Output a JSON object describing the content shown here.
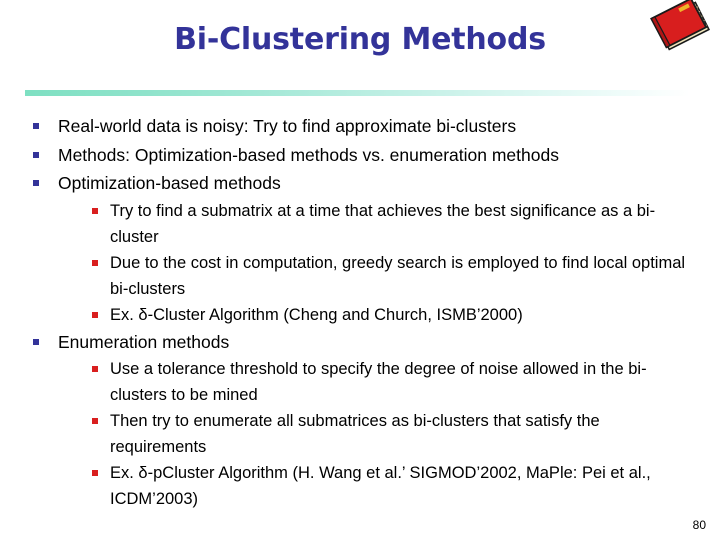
{
  "slide": {
    "title": "Bi-Clustering Methods",
    "page_number": "80",
    "title_color": "#333399",
    "divider_color": "#7ee0c2",
    "level1_bullet_color": "#333399",
    "level2_bullet_color": "#d91f1f",
    "decoration_icon": "red-book-icon"
  },
  "bullets": [
    {
      "level": 1,
      "text": "Real-world data is noisy: Try to find approximate bi-clusters"
    },
    {
      "level": 1,
      "text": "Methods: Optimization-based methods vs. enumeration methods"
    },
    {
      "level": 1,
      "text": "Optimization-based methods"
    },
    {
      "level": 2,
      "text": "Try to find a submatrix at a time that achieves the best significance as a bi-cluster"
    },
    {
      "level": 2,
      "text": "Due to the cost in computation, greedy search is employed to find local optimal bi-clusters"
    },
    {
      "level": 2,
      "text": "Ex. δ-Cluster Algorithm (Cheng and Church, ISMB’2000)"
    },
    {
      "level": 1,
      "text": "Enumeration methods"
    },
    {
      "level": 2,
      "text": "Use a tolerance threshold to specify the degree of noise allowed in the bi-clusters to be mined"
    },
    {
      "level": 2,
      "text": "Then try to enumerate all submatrices as bi-clusters that satisfy the requirements"
    },
    {
      "level": 2,
      "text": "Ex. δ-pCluster Algorithm (H. Wang et al.’ SIGMOD’2002, MaPle: Pei et al., ICDM’2003)"
    }
  ]
}
